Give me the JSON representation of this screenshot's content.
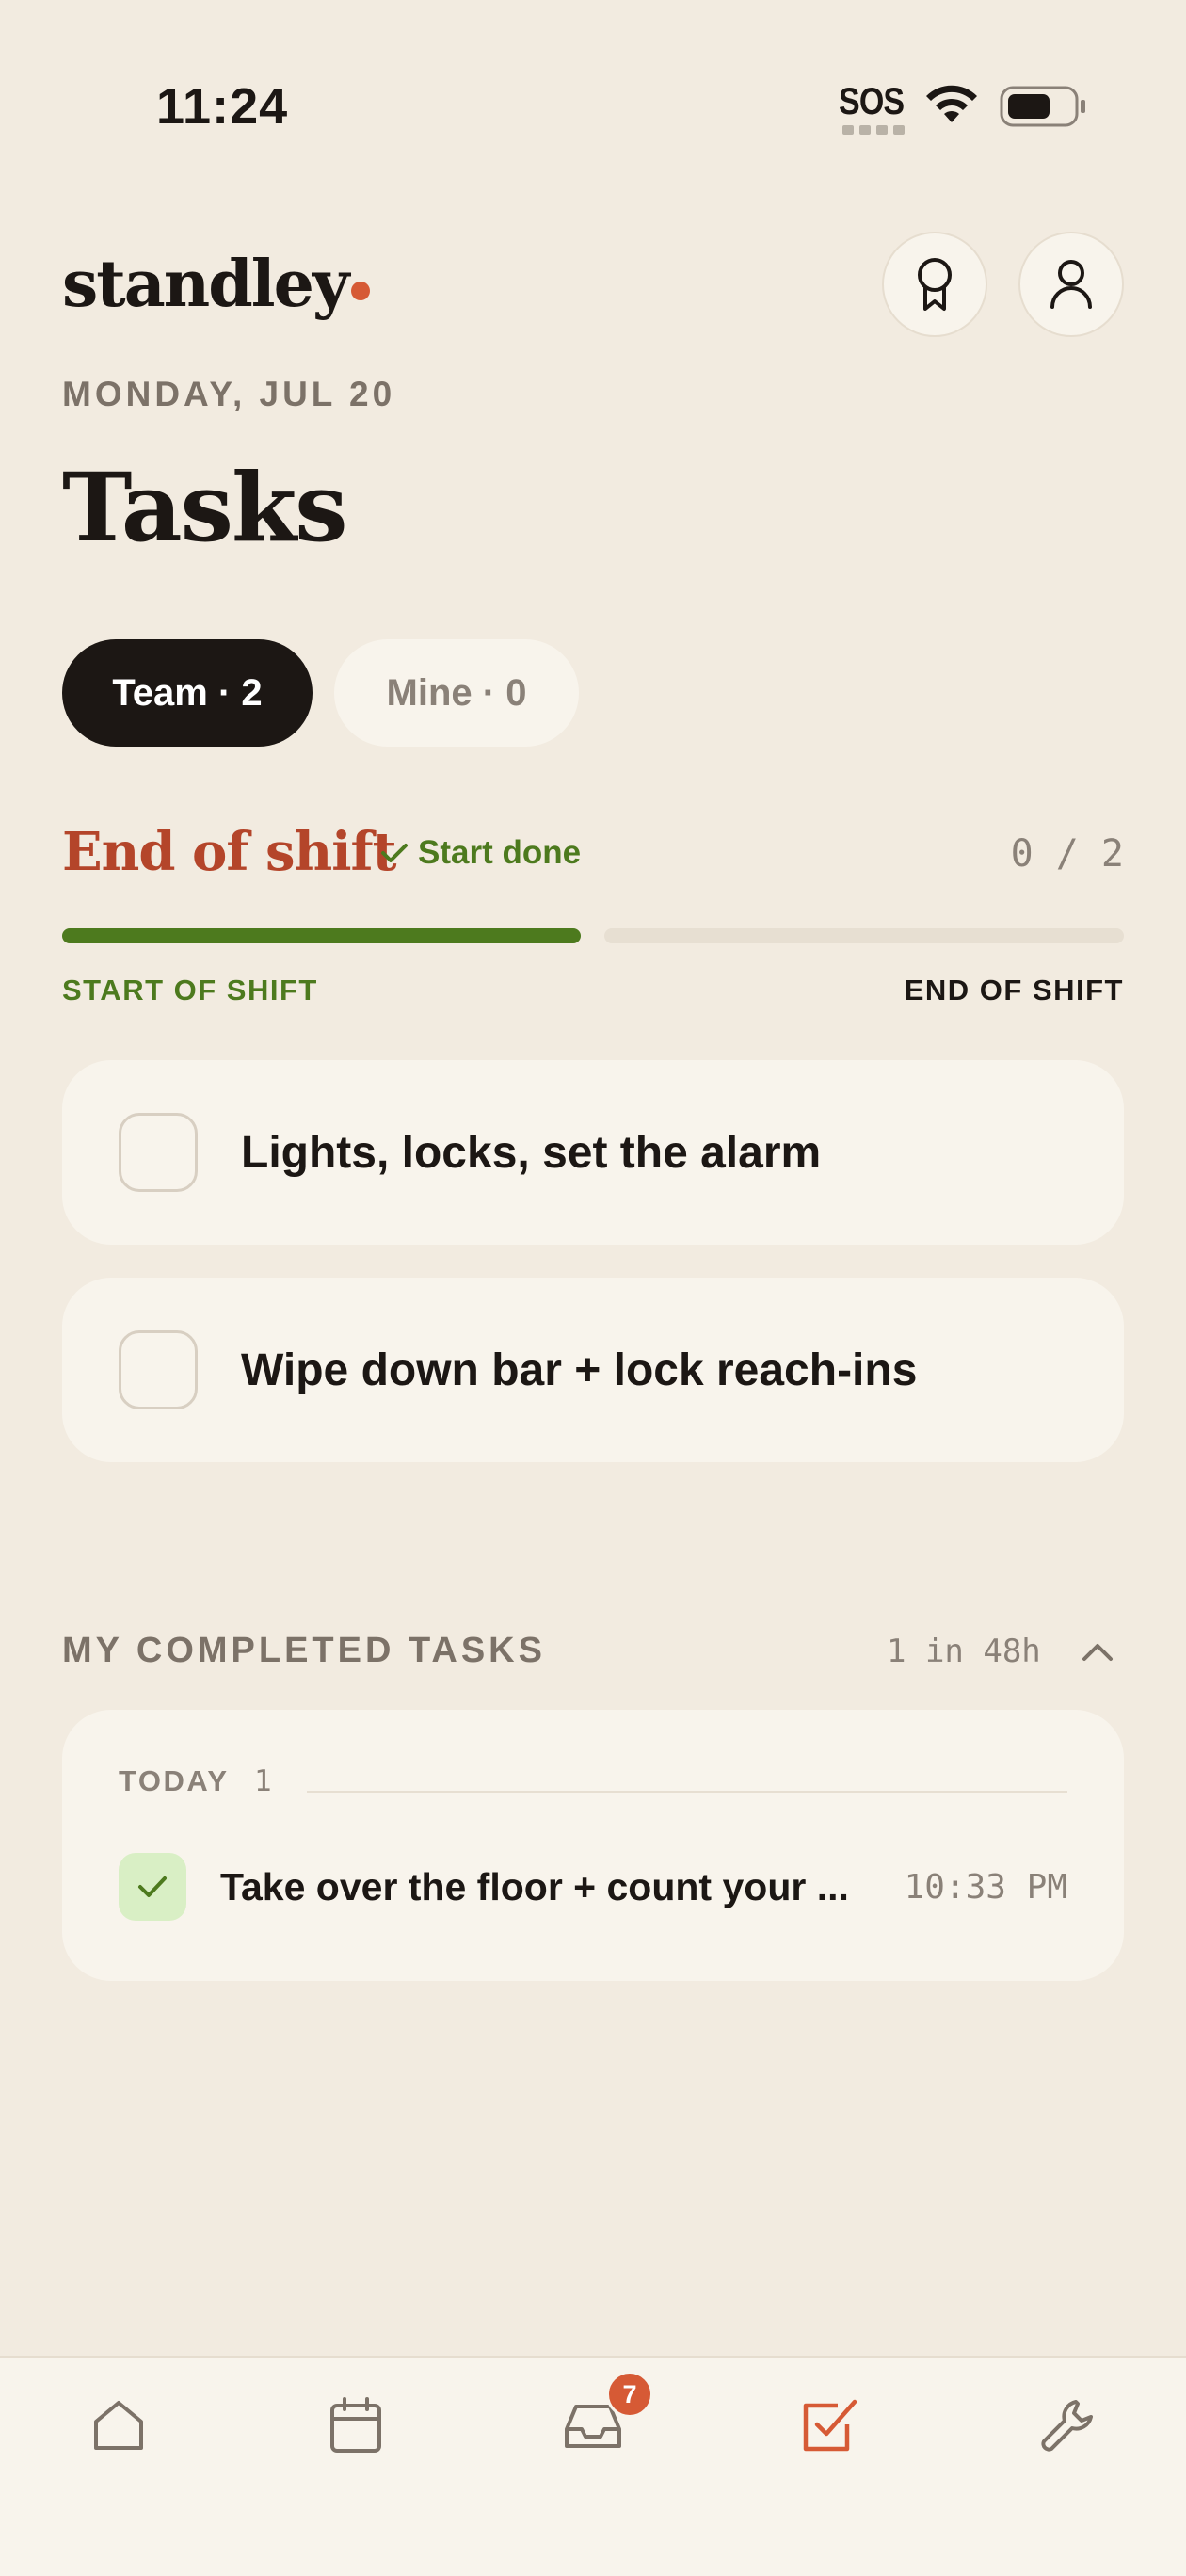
{
  "status_bar": {
    "time": "11:24",
    "sos": "SOS",
    "icons": [
      "wifi-icon",
      "battery-icon"
    ]
  },
  "header": {
    "logo": "standley",
    "logo_dot_color": "#d65a35",
    "buttons": [
      "award-icon",
      "user-icon"
    ]
  },
  "date": "MONDAY, JUL 20",
  "title": "Tasks",
  "segments": [
    {
      "label": "Team · 2",
      "active": true
    },
    {
      "label": "Mine · 0",
      "active": false
    }
  ],
  "section": {
    "title": "End of shift",
    "start_done": "Start done",
    "progress": "0 / 2",
    "phases_done_fraction": 0.5,
    "start_label": "START OF SHIFT",
    "end_label": "END OF SHIFT",
    "accent_color": "#b4452a",
    "done_color": "#4d7a1e"
  },
  "tasks": [
    {
      "label": "Lights, locks, set the alarm",
      "checked": false
    },
    {
      "label": "Wipe down bar + lock reach-ins",
      "checked": false
    }
  ],
  "completed": {
    "heading": "MY COMPLETED TASKS",
    "count_text": "1 in 48h",
    "groups": [
      {
        "label": "TODAY",
        "count": "1",
        "items": [
          {
            "label": "Take over the floor + count your ...",
            "time": "10:33 PM",
            "checked": true
          }
        ]
      }
    ]
  },
  "tabbar": {
    "items": [
      {
        "icon": "home-icon",
        "active": false
      },
      {
        "icon": "calendar-icon",
        "active": false
      },
      {
        "icon": "inbox-icon",
        "active": false,
        "badge": "7"
      },
      {
        "icon": "tasks-icon",
        "active": true
      },
      {
        "icon": "wrench-icon",
        "active": false
      }
    ],
    "active_color": "#d65a35"
  }
}
